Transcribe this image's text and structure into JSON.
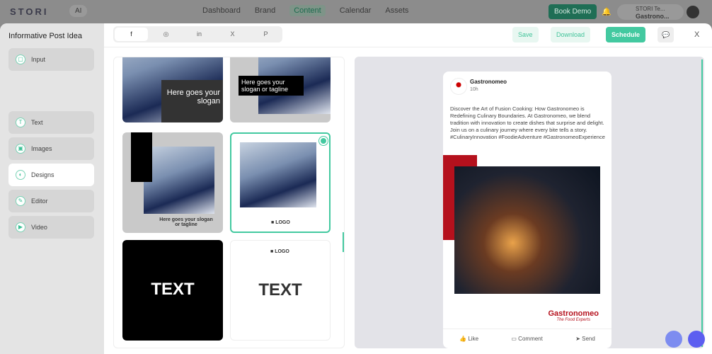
{
  "topnav": {
    "logo": "STORI",
    "ai": "AI",
    "items": [
      "Dashboard",
      "Brand",
      "Content",
      "Calendar",
      "Assets"
    ],
    "book_demo": "Book Demo",
    "account_line1": "STORI Te...",
    "account_line2": "Gastrono..."
  },
  "sidebar": {
    "title": "Informative Post Idea",
    "items": [
      {
        "label": "Input"
      },
      {
        "label": "Text"
      },
      {
        "label": "Images"
      },
      {
        "label": "Designs"
      },
      {
        "label": "Editor"
      },
      {
        "label": "Video"
      }
    ]
  },
  "header": {
    "tabs": [
      "f",
      "◎",
      "in",
      "X",
      "P"
    ],
    "save": "Save",
    "download": "Download",
    "schedule": "Schedule",
    "close": "X"
  },
  "templates": {
    "slogan1": "Here goes your slogan",
    "slogan2": "Here goes your slogan or tagline",
    "slogan3": "Here goes your slogan or tagline",
    "logo": "LOGO",
    "text": "TEXT"
  },
  "post": {
    "name": "Gastronomeo",
    "time": "10h",
    "body": "Discover the Art of Fusion Cooking: How Gastronomeo is Redefining Culinary Boundaries. At Gastronomeo, we blend tradition with innovation to create dishes that surprise and delight. Join us on a culinary journey where every bite tells a story. #CulinaryInnovation #FoodieAdventure #GastronomeoExperience",
    "brand": "Gastronomeo",
    "tagline": "The Food Experts",
    "like": "Like",
    "comment": "Comment",
    "send": "Send"
  }
}
